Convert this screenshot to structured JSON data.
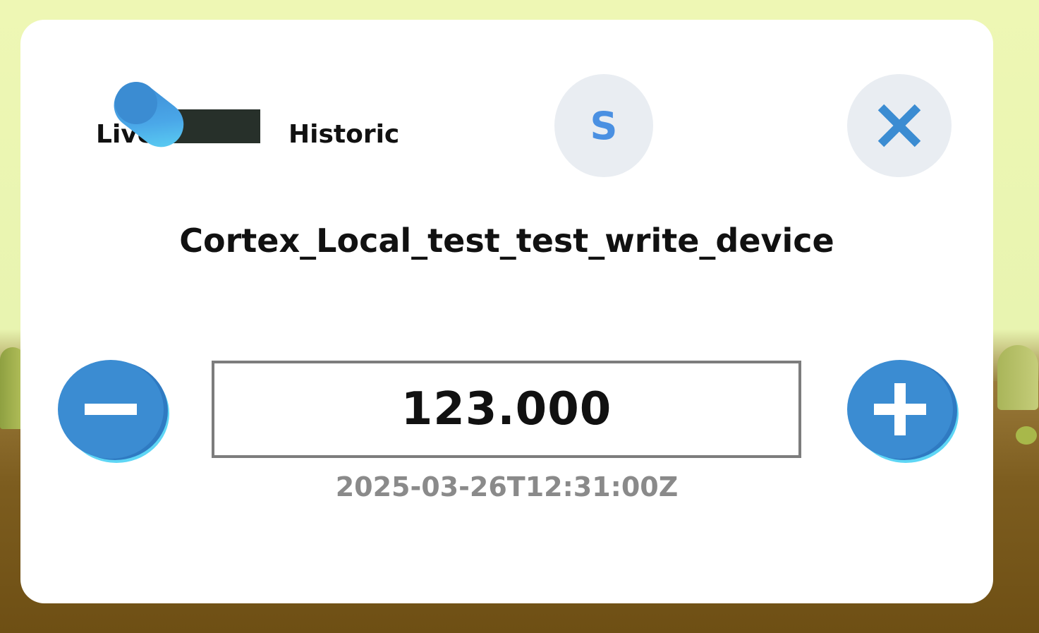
{
  "toggle": {
    "left_label": "Live",
    "right_label": "Historic",
    "selected": "Live"
  },
  "header_buttons": {
    "s_label": "S",
    "close_icon": "close-icon"
  },
  "device": {
    "name": "Cortex_Local_test_test_write_device"
  },
  "stepper": {
    "value": "123.000",
    "timestamp": "2025-03-26T12:31:00Z",
    "decrement_icon": "minus-icon",
    "increment_icon": "plus-icon"
  },
  "colors": {
    "accent_blue": "#3b8cd2",
    "s_letter": "#4a90e2",
    "toggle_track": "#27302a",
    "timestamp_gray": "#8a8a8a"
  }
}
